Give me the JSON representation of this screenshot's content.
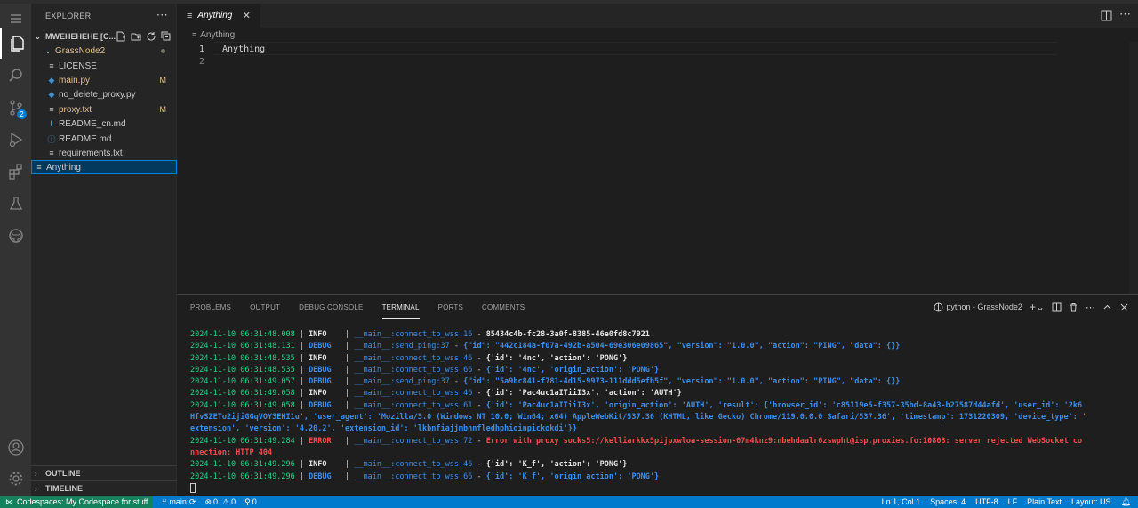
{
  "colors": {
    "accent": "#007acc",
    "remote": "#16825d",
    "modified": "#e2c08d",
    "timestamp": "#23d18b",
    "debug": "#3b8eea",
    "error": "#f14c4c"
  },
  "activity_bar": {
    "scm_badge": "2"
  },
  "explorer": {
    "header": "EXPLORER",
    "root": "MWEHEHEHE [C...",
    "folder": "GrassNode2",
    "files": [
      {
        "name": "LICENSE",
        "icon": "license-icon",
        "status": ""
      },
      {
        "name": "main.py",
        "icon": "python-icon",
        "status": "M"
      },
      {
        "name": "no_delete_proxy.py",
        "icon": "python-icon",
        "status": ""
      },
      {
        "name": "proxy.txt",
        "icon": "text-file-icon",
        "status": "M"
      },
      {
        "name": "README_cn.md",
        "icon": "markdown-icon",
        "status": ""
      },
      {
        "name": "README.md",
        "icon": "info-icon",
        "status": ""
      },
      {
        "name": "requirements.txt",
        "icon": "text-file-icon",
        "status": ""
      }
    ],
    "selected_file": "Anything",
    "outline": "OUTLINE",
    "timeline": "TIMELINE"
  },
  "editor": {
    "tab_label": "Anything",
    "breadcrumb": "Anything",
    "lines": [
      {
        "number": "1",
        "text": "Anything"
      },
      {
        "number": "2",
        "text": ""
      }
    ]
  },
  "panel": {
    "tabs": [
      "PROBLEMS",
      "OUTPUT",
      "DEBUG CONSOLE",
      "TERMINAL",
      "PORTS",
      "COMMENTS"
    ],
    "active_tab": "TERMINAL",
    "terminal_name": "python - GrassNode2",
    "terminal_lines": [
      {
        "ts": "2024-11-10 06:31:48.008",
        "level": "INFO",
        "fn": "__main__:connect_to_wss:16",
        "msg": "85434c4b-fc28-3a0f-8385-46e0fd8c7921"
      },
      {
        "ts": "2024-11-10 06:31:48.131",
        "level": "DEBUG",
        "fn": "__main__:send_ping:37",
        "msg": "{\"id\": \"442c184a-f07a-492b-a504-69e306e09865\", \"version\": \"1.0.0\", \"action\": \"PING\", \"data\": {}}"
      },
      {
        "ts": "2024-11-10 06:31:48.535",
        "level": "INFO",
        "fn": "__main__:connect_to_wss:46",
        "msg": "{'id': '4nc', 'action': 'PONG'}"
      },
      {
        "ts": "2024-11-10 06:31:48.535",
        "level": "DEBUG",
        "fn": "__main__:connect_to_wss:66",
        "msg": "{'id': '4nc', 'origin_action': 'PONG'}"
      },
      {
        "ts": "2024-11-10 06:31:49.057",
        "level": "DEBUG",
        "fn": "__main__:send_ping:37",
        "msg": "{\"id\": \"5a9bc841-f781-4d15-9973-111ddd5efb5f\", \"version\": \"1.0.0\", \"action\": \"PING\", \"data\": {}}"
      },
      {
        "ts": "2024-11-10 06:31:49.058",
        "level": "INFO",
        "fn": "__main__:connect_to_wss:46",
        "msg": "{'id': 'Pac4uc1aITiiI3x', 'action': 'AUTH'}"
      },
      {
        "ts": "2024-11-10 06:31:49.058",
        "level": "DEBUG",
        "fn": "__main__:connect_to_wss:61",
        "msg": "{'id': 'Pac4uc1aITiiI3x', 'origin_action': 'AUTH', 'result': {'browser_id': 'c85119e5-f357-35bd-8a43-b27587d44afd', 'user_id': '2k6"
      },
      {
        "cont": "HfvSZETo2ijiGGqVOY3EHI1u', 'user_agent': 'Mozilla/5.0 (Windows NT 10.0; Win64; x64) AppleWebKit/537.36 (KHTML, like Gecko) Chrome/119.0.0.0 Safari/537.36', 'timestamp': 1731220309, 'device_type': '",
        "level": "DEBUG"
      },
      {
        "cont": "extension', 'version': '4.20.2', 'extension_id': 'lkbnfiajjmbhnfledhphioinpickokdi'}}",
        "level": "DEBUG"
      },
      {
        "ts": "2024-11-10 06:31:49.284",
        "level": "ERROR",
        "fn": "__main__:connect_to_wss:72",
        "msg": "Error with proxy socks5://kelliarkkx5pijpxwloa-session-07m4knz9:nbehdaalr6zswpht@isp.proxies.fo:10808: server rejected WebSocket co"
      },
      {
        "cont": "nnection: HTTP 404",
        "level": "ERROR"
      },
      {
        "ts": "2024-11-10 06:31:49.296",
        "level": "INFO",
        "fn": "__main__:connect_to_wss:46",
        "msg": "{'id': 'K_f', 'action': 'PONG'}"
      },
      {
        "ts": "2024-11-10 06:31:49.296",
        "level": "DEBUG",
        "fn": "__main__:connect_to_wss:66",
        "msg": "{'id': 'K_f', 'origin_action': 'PONG'}"
      }
    ]
  },
  "statusbar": {
    "remote": "Codespaces: My Codespace for stuff",
    "branch": "main",
    "errors": "0",
    "warnings": "0",
    "ports": "0",
    "position": "Ln 1, Col 1",
    "spaces": "Spaces: 4",
    "encoding": "UTF-8",
    "eol": "LF",
    "language": "Plain Text",
    "layout": "Layout: US"
  }
}
